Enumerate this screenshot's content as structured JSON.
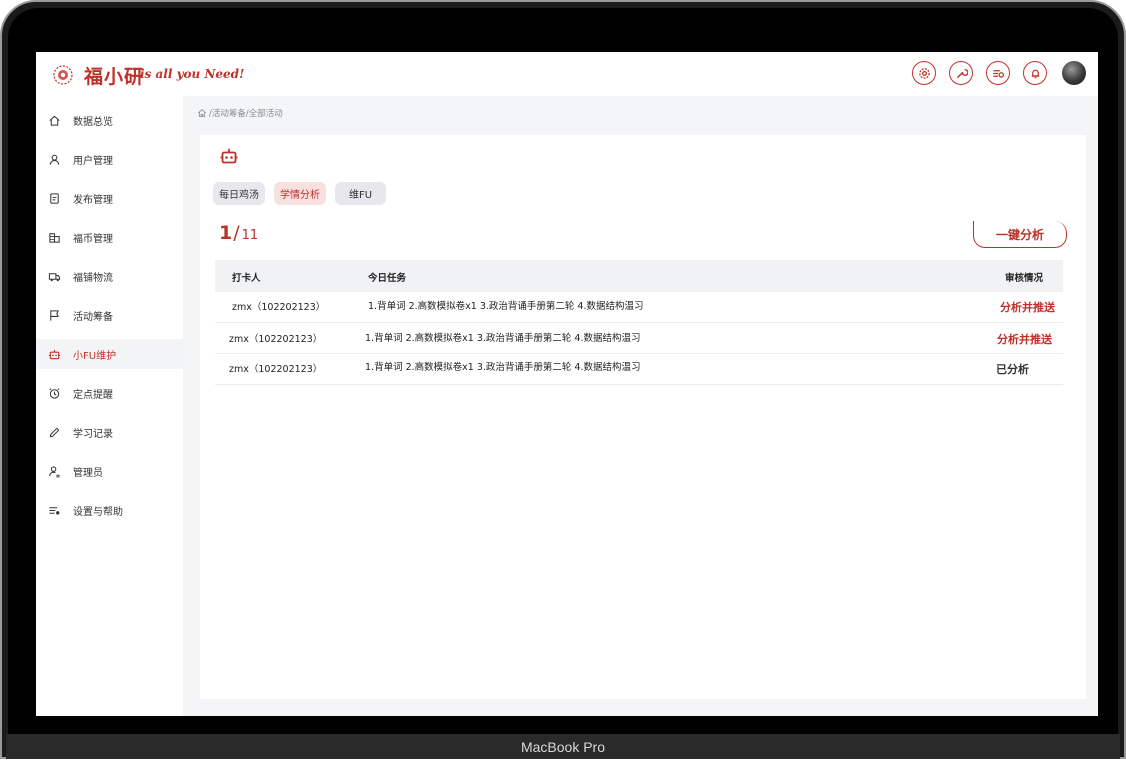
{
  "device_label": "MacBook Pro",
  "header": {
    "brand": "福小研",
    "tagline": "is all you Need!",
    "icons": [
      "settings-icon",
      "wrench-icon",
      "search-list-icon",
      "bell-icon"
    ]
  },
  "sidebar": {
    "items": [
      {
        "label": "数据总览",
        "icon": "home-icon"
      },
      {
        "label": "用户管理",
        "icon": "user-icon"
      },
      {
        "label": "发布管理",
        "icon": "document-icon"
      },
      {
        "label": "福币管理",
        "icon": "coins-icon"
      },
      {
        "label": "福铺物流",
        "icon": "truck-icon"
      },
      {
        "label": "活动筹备",
        "icon": "flag-icon"
      },
      {
        "label": "小FU维护",
        "icon": "robot-icon",
        "active": true
      },
      {
        "label": "定点提醒",
        "icon": "alarm-icon"
      },
      {
        "label": "学习记录",
        "icon": "pencil-icon"
      },
      {
        "label": "管理员",
        "icon": "admin-icon"
      },
      {
        "label": "设置与帮助",
        "icon": "settings-list-icon"
      }
    ]
  },
  "breadcrumb": "/活动筹备/全部活动",
  "tabs": [
    {
      "label": "每日鸡汤"
    },
    {
      "label": "学情分析",
      "active": true
    },
    {
      "label": "维FU"
    }
  ],
  "counter": {
    "current": "1",
    "separator": "/",
    "total": "11"
  },
  "analyze_button": "一键分析",
  "table": {
    "columns": [
      "打卡人",
      "今日任务",
      "审核情况"
    ],
    "rows": [
      {
        "user": "zmx（102202123）",
        "task": "1.背单词 2.高数模拟卷x1 3.政治背诵手册第二轮 4.数据结构温习",
        "status": "分析并推送",
        "status_type": "action"
      },
      {
        "user": "zmx（102202123）",
        "task": "1.背单词 2.高数模拟卷x1 3.政治背诵手册第二轮 4.数据结构温习",
        "status": "分析并推送",
        "status_type": "action"
      },
      {
        "user": "zmx（102202123）",
        "task": "1.背单词 2.高数模拟卷x1 3.政治背诵手册第二轮 4.数据结构温习",
        "status": "已分析",
        "status_type": "done"
      }
    ]
  },
  "colors": {
    "accent": "#c0302a",
    "sidebar_active_bg": "#f3f4f6",
    "main_bg": "#f4f5f7"
  }
}
